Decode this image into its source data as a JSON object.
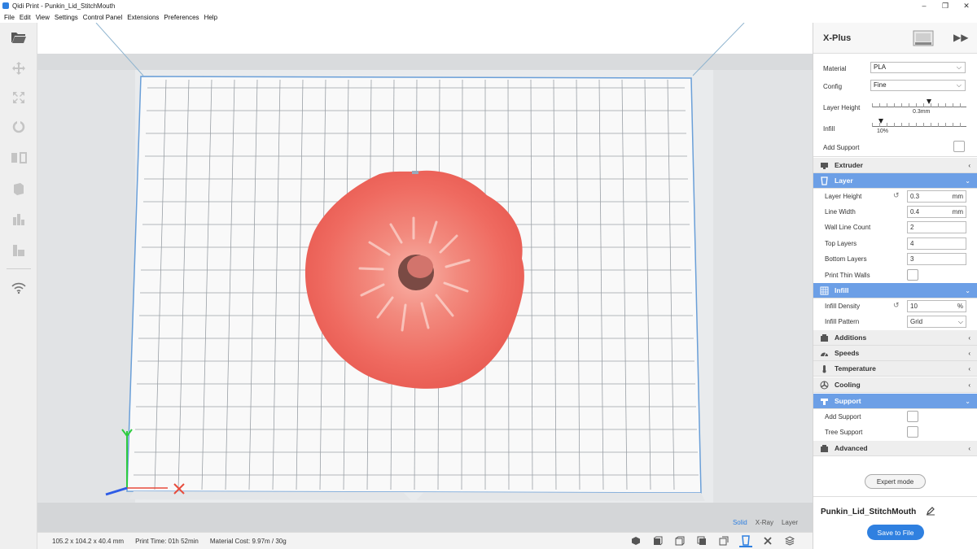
{
  "window": {
    "title": "Qidi Print - Punkin_Lid_StitchMouth",
    "controls": [
      "–",
      "❐",
      "✕"
    ]
  },
  "menu": [
    "File",
    "Edit",
    "View",
    "Settings",
    "Control Panel",
    "Extensions",
    "Preferences",
    "Help"
  ],
  "left_toolbar": {
    "icons": [
      "folder-open-icon",
      "move-icon",
      "scale-icon",
      "rotate-icon",
      "mirror-icon",
      "per-model-settings-icon",
      "support-blocker-icon",
      "layer-tool-icon",
      "wifi-icon"
    ]
  },
  "viewport": {
    "view_modes": [
      "Solid",
      "X-Ray",
      "Layer"
    ],
    "active_view_mode": "Solid",
    "model_color": "#f0635a"
  },
  "status": {
    "dimensions": "105.2 x 104.2 x 40.4 mm",
    "print_time": "Print Time: 01h 52min",
    "material_cost": "Material Cost: 9.97m / 30g"
  },
  "panel": {
    "printer": "X-Plus",
    "basic": {
      "material_label": "Material",
      "material_value": "PLA",
      "config_label": "Config",
      "config_value": "Fine",
      "layer_height_label": "Layer Height",
      "layer_height_value": "0.3mm",
      "infill_label": "Infill",
      "infill_value": "10%",
      "add_support_label": "Add Support"
    },
    "sections": {
      "extruder": "Extruder",
      "layer": "Layer",
      "infill": "Infill",
      "additions": "Additions",
      "speeds": "Speeds",
      "temperature": "Temperature",
      "cooling": "Cooling",
      "support": "Support",
      "advanced": "Advanced"
    },
    "layer_settings": {
      "layer_height": {
        "label": "Layer Height",
        "value": "0.3",
        "unit": "mm"
      },
      "line_width": {
        "label": "Line Width",
        "value": "0.4",
        "unit": "mm"
      },
      "wall_line_count": {
        "label": "Wall Line Count",
        "value": "2"
      },
      "top_layers": {
        "label": "Top Layers",
        "value": "4"
      },
      "bottom_layers": {
        "label": "Bottom Layers",
        "value": "3"
      },
      "print_thin_walls": {
        "label": "Print Thin Walls"
      }
    },
    "infill_settings": {
      "density": {
        "label": "Infill Density",
        "value": "10",
        "unit": "%"
      },
      "pattern": {
        "label": "Infill Pattern",
        "value": "Grid"
      }
    },
    "support_settings": {
      "add_support": {
        "label": "Add Support"
      },
      "tree_support": {
        "label": "Tree Support"
      }
    },
    "expert_mode": "Expert mode",
    "job_name": "Punkin_Lid_StitchMouth",
    "save_button": "Save to File",
    "accent": "#2f80e0"
  }
}
